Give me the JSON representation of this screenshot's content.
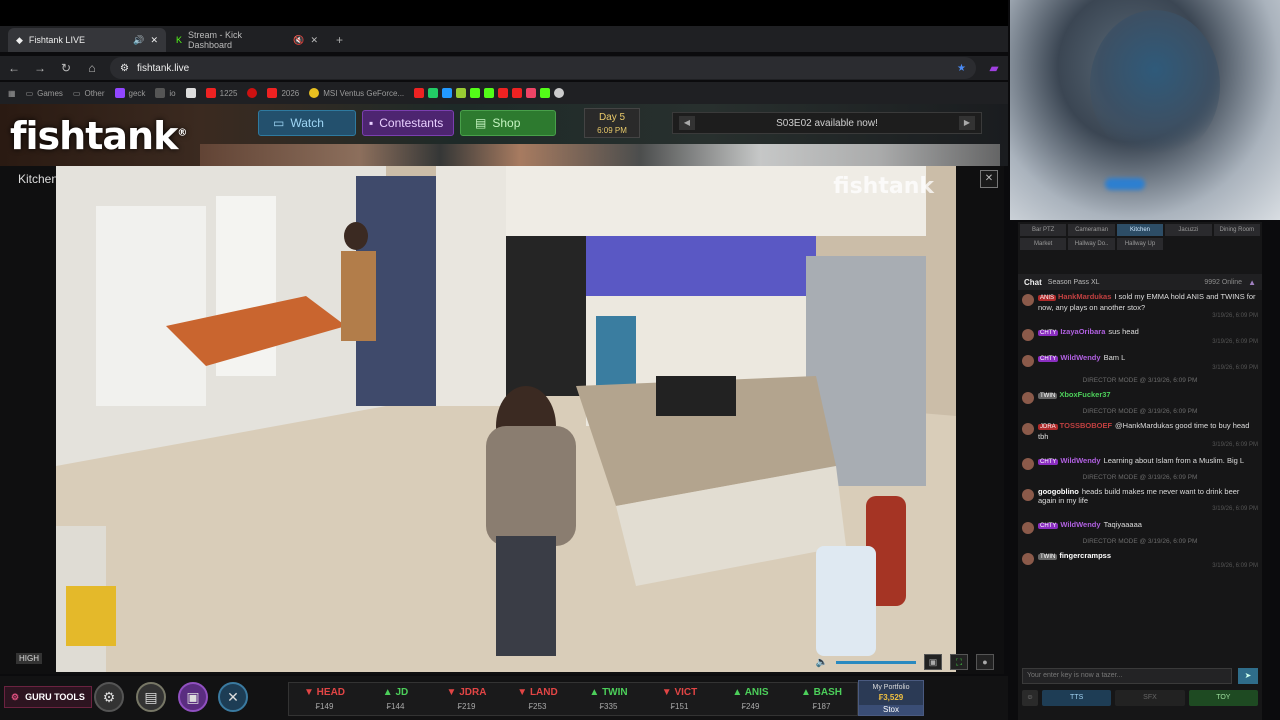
{
  "browser": {
    "tabs": [
      {
        "label": "Fishtank LIVE",
        "active": true
      },
      {
        "label": "Stream - Kick Dashboard",
        "active": false
      }
    ],
    "url": "fishtank.live",
    "bookmarks": [
      "Games",
      "Other",
      "geck",
      "io",
      "1225",
      "2026",
      "MSI Ventus GeForce..."
    ]
  },
  "site": {
    "logo": "fishtank",
    "nav": {
      "watch": "Watch",
      "contestants": "Contestants",
      "shop": "Shop"
    },
    "day": "Day 5",
    "time": "6:09 PM",
    "announcement": "S03E02 available now!"
  },
  "player": {
    "room": "Kitchen",
    "watermark": "fishtank",
    "quality": "HIGH"
  },
  "right_panel": {
    "cam_tabs": [
      {
        "label": "Bar PTZ",
        "active": false
      },
      {
        "label": "Cameraman",
        "active": false
      },
      {
        "label": "Kitchen",
        "active": true
      },
      {
        "label": "Jacuzzi",
        "active": false
      },
      {
        "label": "Dining Room",
        "active": false
      },
      {
        "label": "Market",
        "active": false
      },
      {
        "label": "Hallway Do..",
        "active": false
      },
      {
        "label": "Hallway Up",
        "active": false
      }
    ],
    "chat_title": "Chat",
    "season_pass": "Season Pass XL",
    "online": "9992 Online",
    "messages": [
      {
        "clan": "ANIS",
        "clan_color": "#b02a2a",
        "user": "HankMardukas",
        "user_color": "#c04040",
        "text": "I sold my EMMA hold ANIS and TWINS for now, any plays on another stox?",
        "ts": "3/19/26, 6:09 PM"
      },
      {
        "clan": "CHTY",
        "clan_color": "#8a2ec0",
        "user": "IzayaOribara",
        "user_color": "#b060e0",
        "text": "sus head",
        "ts": "3/19/26, 6:09 PM"
      },
      {
        "clan": "CHTY",
        "clan_color": "#8a2ec0",
        "user": "WildWendy",
        "user_color": "#b060e0",
        "text": "Bam L",
        "ts": "3/19/26, 6:09 PM"
      },
      {
        "system": "DIRECTOR MODE @ 3/19/26, 6:09 PM"
      },
      {
        "clan": "TWIN",
        "clan_color": "#666",
        "user": "XboxFucker37",
        "user_color": "#4ccf5a",
        "text": "",
        "ts": ""
      },
      {
        "system": "DIRECTOR MODE @ 3/19/26, 6:09 PM"
      },
      {
        "clan": "JDRA",
        "clan_color": "#b02a2a",
        "user": "TOSSBOBOEF",
        "user_color": "#c04040",
        "text": "@HankMardukas good time to buy head tbh",
        "ts": "3/19/26, 6:09 PM"
      },
      {
        "clan": "CHTY",
        "clan_color": "#8a2ec0",
        "user": "WildWendy",
        "user_color": "#b060e0",
        "text": "Learning about Islam from a Muslim. Big L",
        "ts": ""
      },
      {
        "system": "DIRECTOR MODE @ 3/19/26, 6:09 PM"
      },
      {
        "clan": "",
        "clan_color": "",
        "user": "googoblino",
        "user_color": "#ffffff",
        "text": "heads build makes me never want to drink beer again in my life",
        "ts": "3/19/26, 6:09 PM"
      },
      {
        "clan": "CHTY",
        "clan_color": "#8a2ec0",
        "user": "WildWendy",
        "user_color": "#b060e0",
        "text": "Taqiyaaaaa",
        "ts": ""
      },
      {
        "system": "DIRECTOR MODE @ 3/19/26, 6:09 PM"
      },
      {
        "clan": "TWIN",
        "clan_color": "#666",
        "user": "fingercrampss",
        "user_color": "#ffffff",
        "text": "",
        "ts": "3/19/26, 6:09 PM"
      }
    ],
    "input_placeholder": "Your enter key is now a tazer...",
    "tools": {
      "tts": "TTS",
      "sfx": "SFX",
      "toy": "TOY"
    }
  },
  "bottombar": {
    "guru_tools": "GURU TOOLS",
    "stocks": [
      {
        "name": "HEAD",
        "price": "₣149",
        "dir": "down"
      },
      {
        "name": "JD",
        "price": "₣144",
        "dir": "up"
      },
      {
        "name": "JDRA",
        "price": "₣219",
        "dir": "down"
      },
      {
        "name": "LAND",
        "price": "₣253",
        "dir": "down"
      },
      {
        "name": "TWIN",
        "price": "₣335",
        "dir": "up"
      },
      {
        "name": "VICT",
        "price": "₣151",
        "dir": "down"
      },
      {
        "name": "ANIS",
        "price": "₣249",
        "dir": "up"
      },
      {
        "name": "BASH",
        "price": "₣187",
        "dir": "up"
      }
    ],
    "portfolio_label": "My Portfolio",
    "portfolio_value": "₣3,529",
    "stox_label": "Stox"
  }
}
